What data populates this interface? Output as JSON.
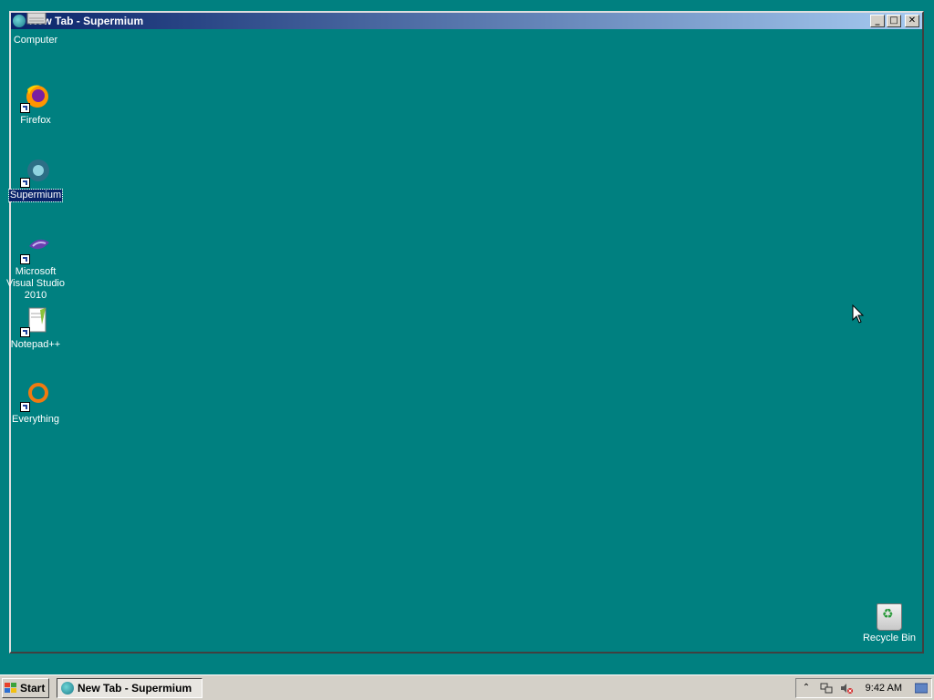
{
  "window": {
    "title": "New Tab - Supermium"
  },
  "desktop": {
    "icons": [
      {
        "label": "Computer"
      },
      {
        "label": "Firefox"
      },
      {
        "label": "Supermium"
      },
      {
        "label": "Microsoft Visual Studio 2010"
      },
      {
        "label": "Notepad++"
      },
      {
        "label": "Everything"
      },
      {
        "label": "Recycle Bin"
      }
    ],
    "background_color": "#008080"
  },
  "taskbar": {
    "start_label": "Start",
    "task_label": "New Tab - Supermium",
    "clock": "9:42 AM"
  },
  "colors": {
    "titlebar_start": "#0a246a",
    "titlebar_end": "#a6caf0",
    "selection": "#0a246a",
    "chrome": "#d4d0c8"
  }
}
